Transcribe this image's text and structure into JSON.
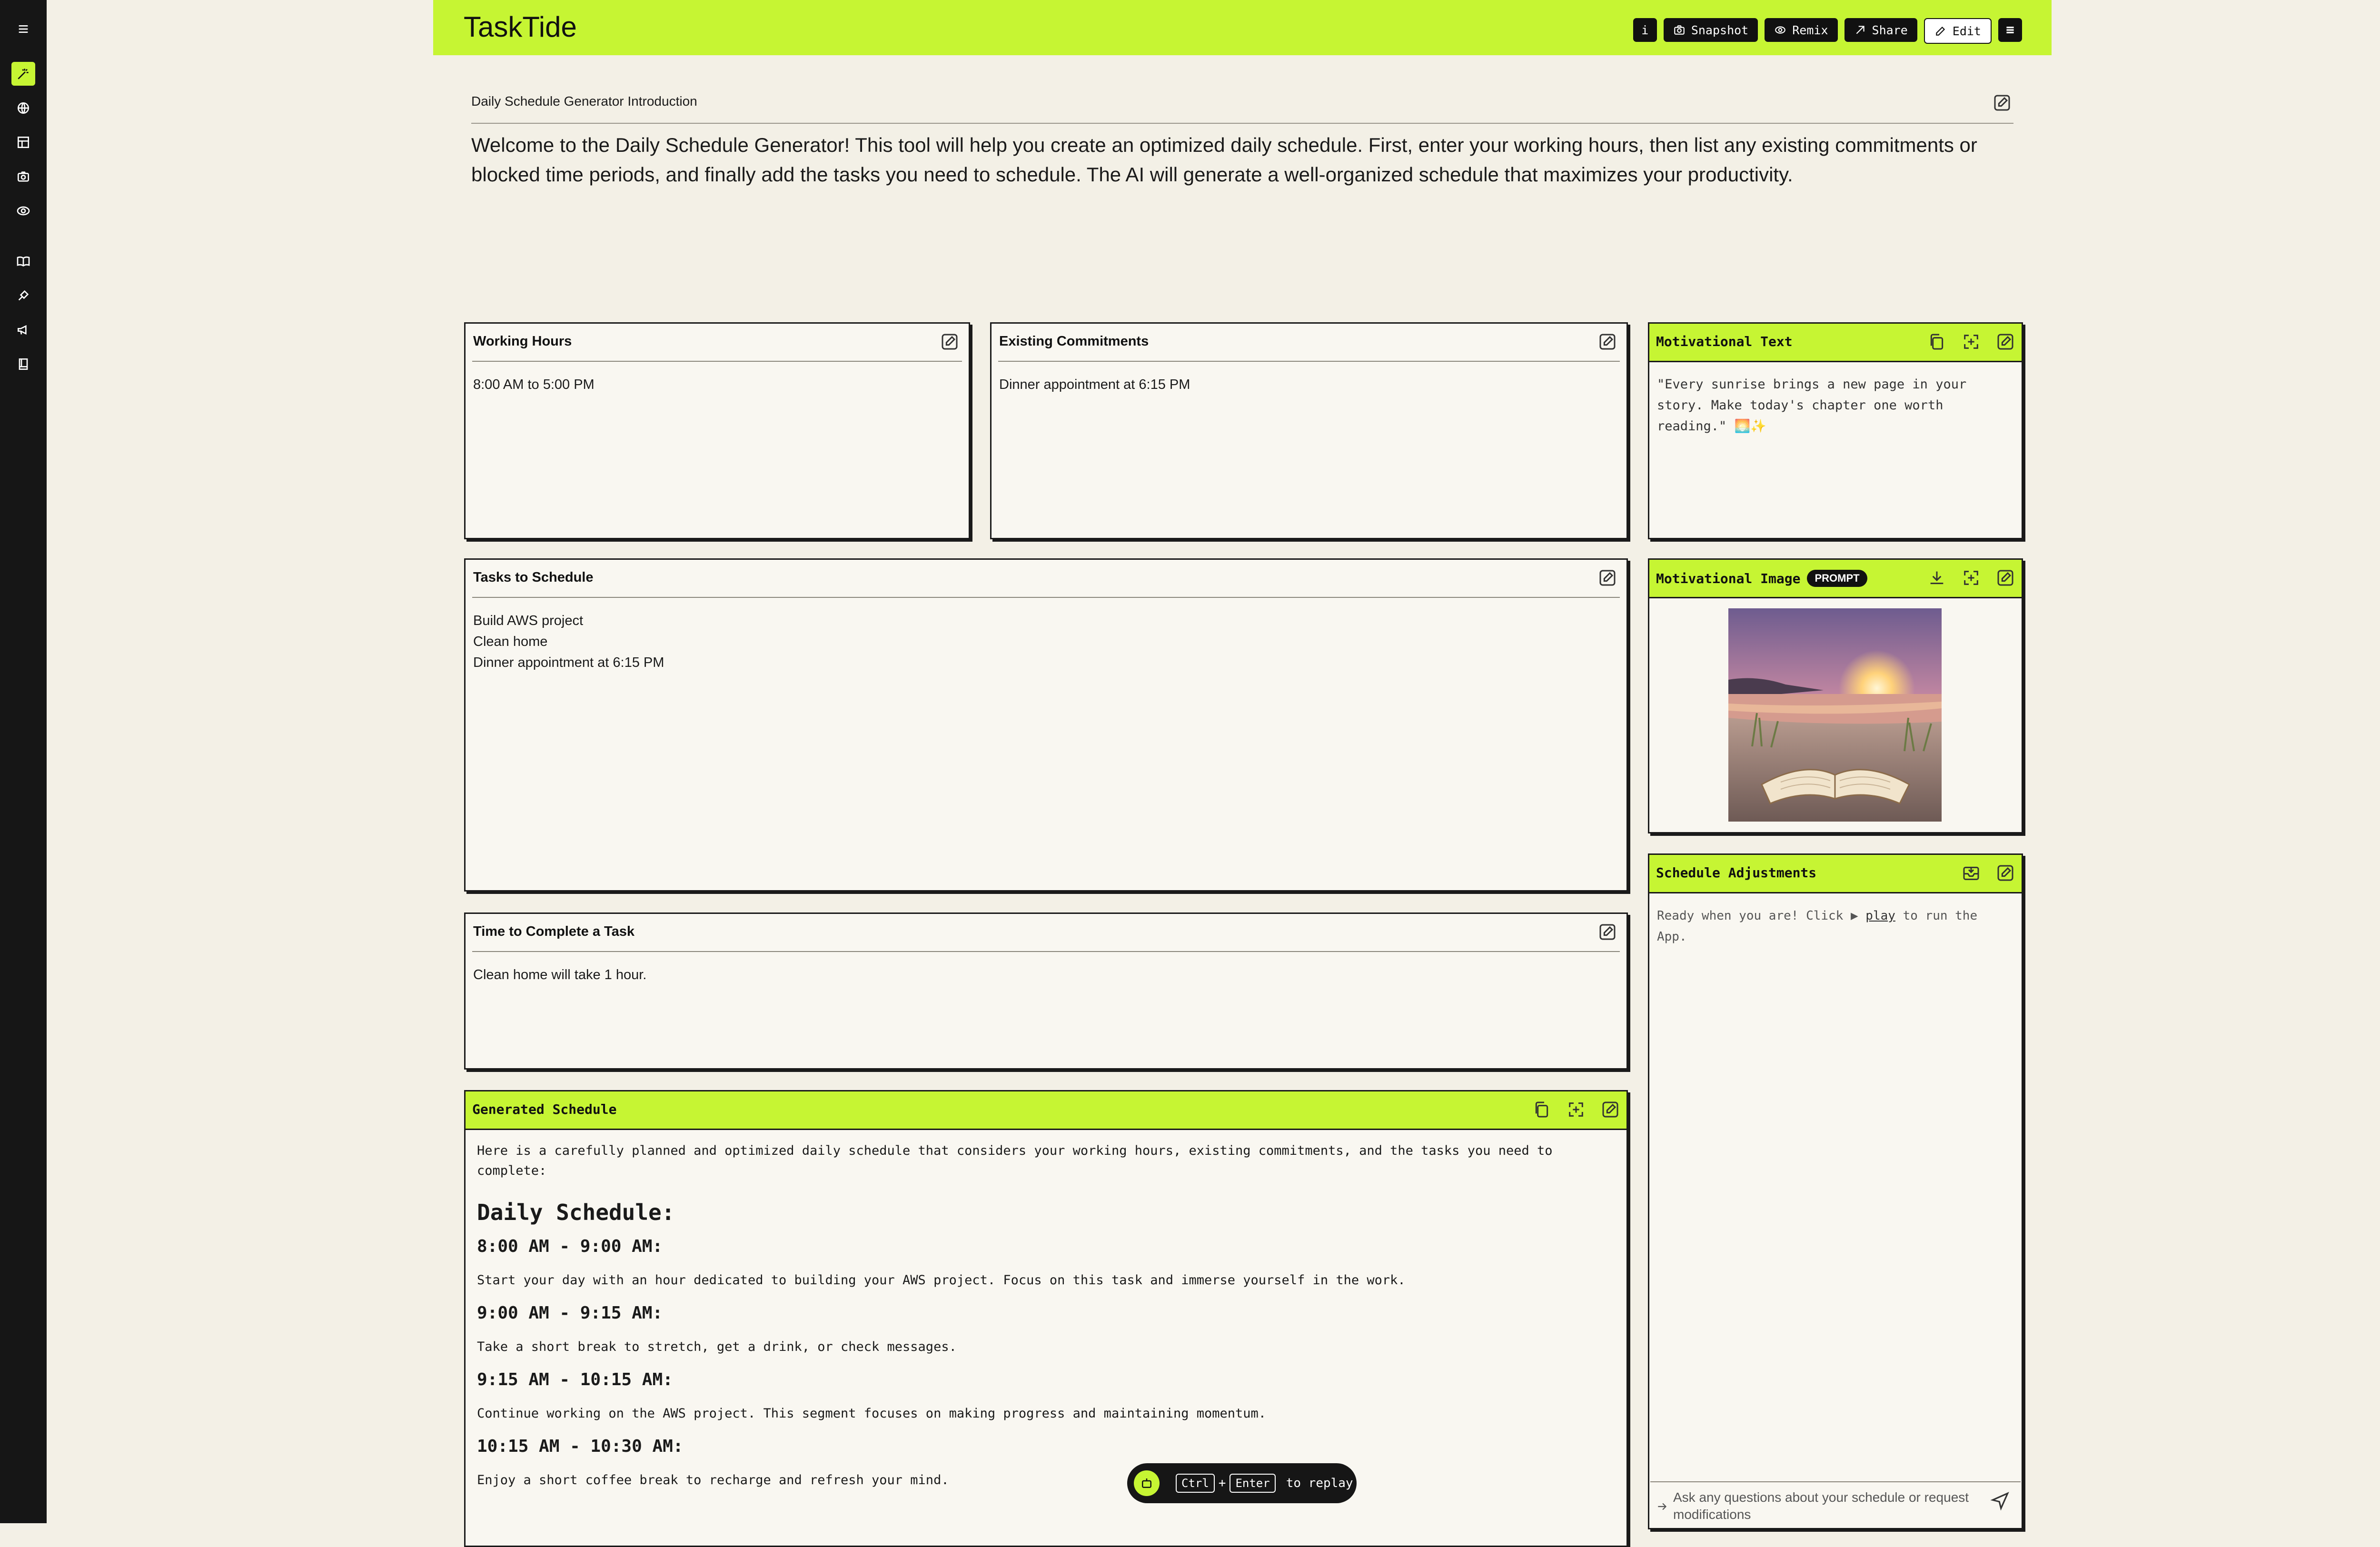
{
  "app": {
    "title": "TaskTide"
  },
  "toolbar": {
    "info_label": "i",
    "snapshot_label": "Snapshot",
    "remix_label": "Remix",
    "share_label": "Share",
    "edit_label": "Edit"
  },
  "intro": {
    "title": "Daily Schedule Generator Introduction",
    "text": "Welcome to the Daily Schedule Generator! This tool will help you create an optimized daily schedule. First, enter your working hours, then list any existing commitments or blocked time periods, and finally add the tasks you need to schedule. The AI will generate a well-organized schedule that maximizes your productivity."
  },
  "working_hours": {
    "title": "Working Hours",
    "value": "8:00 AM to 5:00 PM"
  },
  "commitments": {
    "title": "Existing Commitments",
    "value": "Dinner appointment at 6:15 PM"
  },
  "tasks": {
    "title": "Tasks to Schedule",
    "items": [
      "Build AWS project",
      "Clean home",
      "Dinner appointment at 6:15 PM"
    ]
  },
  "time_to_complete": {
    "title": "Time to Complete a Task",
    "value": "Clean home will take 1 hour."
  },
  "motivational_text": {
    "title": "Motivational Text",
    "value": "\"Every sunrise brings a new page in your story. Make today's chapter one worth reading.\" 🌅✨"
  },
  "motivational_image": {
    "title": "Motivational Image",
    "badge": "PROMPT"
  },
  "adjustments": {
    "title": "Schedule Adjustments",
    "ready_before": "Ready when you are! Click ▶ ",
    "play_link": "play",
    "ready_after": " to run the App.",
    "input_placeholder": "Ask any questions about your schedule or request modifications"
  },
  "schedule": {
    "title": "Generated Schedule",
    "intro": "Here is a carefully planned and optimized daily schedule that considers your working hours, existing commitments, and the tasks you need to complete:",
    "heading": "Daily Schedule:",
    "blocks": [
      {
        "time": "8:00 AM - 9:00 AM:",
        "desc": "Start your day with an hour dedicated to building your AWS project. Focus on this task and immerse yourself in the work."
      },
      {
        "time": "9:00 AM - 9:15 AM:",
        "desc": "Take a short break to stretch, get a drink, or check messages."
      },
      {
        "time": "9:15 AM - 10:15 AM:",
        "desc": "Continue working on the AWS project. This segment focuses on making progress and maintaining momentum."
      },
      {
        "time": "10:15 AM - 10:30 AM:",
        "desc": "Enjoy a short coffee break to recharge and refresh your mind."
      }
    ]
  },
  "replay": {
    "key1": "Ctrl",
    "plus": "+",
    "key2": "Enter",
    "suffix": "to replay"
  },
  "colors": {
    "accent": "#c6f533",
    "sidebar": "#161616",
    "background": "#f3f0e6",
    "card": "#f9f7f1"
  },
  "icons": {
    "sidebar": [
      "menu-icon",
      "magic-wand-icon",
      "globe-icon",
      "layout-icon",
      "camera-icon",
      "eye-swirl-icon",
      "book-icon",
      "pen-tool-icon",
      "megaphone-icon",
      "notebook-icon"
    ],
    "card_actions": [
      "copy-icon",
      "expand-icon",
      "edit-icon",
      "download-icon",
      "inbox-icon"
    ]
  }
}
